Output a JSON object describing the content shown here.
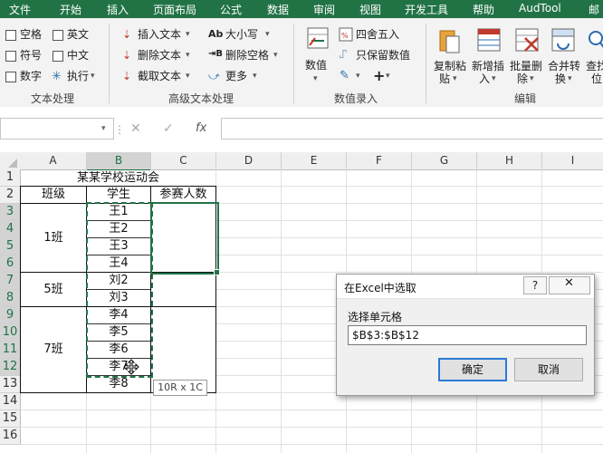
{
  "menu_tabs": [
    "文件",
    "开始",
    "插入",
    "页面布局",
    "公式",
    "数据",
    "审阅",
    "视图",
    "开发工具",
    "帮助",
    "AudTool",
    "邮"
  ],
  "ribbon": {
    "text_group": {
      "options": [
        "空格",
        "英文",
        "符号",
        "中文",
        "数字",
        "执行"
      ],
      "label": "文本处理"
    },
    "advanced_group": {
      "items": [
        "插入文本",
        "删除文本",
        "截取文本",
        "大小写",
        "删除空格",
        "更多"
      ],
      "label": "高级文本处理"
    },
    "value_group": {
      "value_button": "数值",
      "round": "四舍五入",
      "keep_values": "只保留数值",
      "label": "数值录入"
    },
    "edit_group": {
      "buttons": [
        {
          "line1": "复制粘",
          "line2": "贴"
        },
        {
          "line1": "新增插",
          "line2": "入"
        },
        {
          "line1": "批量删",
          "line2": "除"
        },
        {
          "line1": "合并转",
          "line2": "换"
        },
        {
          "line1": "查找",
          "line2": "位"
        }
      ],
      "label": "编辑"
    }
  },
  "formula_bar": {
    "fx": "fx",
    "name_box": "",
    "content": ""
  },
  "sheet": {
    "columns": [
      "A",
      "B",
      "C",
      "D",
      "E",
      "F",
      "G",
      "H",
      "I"
    ],
    "rows": [
      "1",
      "2",
      "3",
      "4",
      "5",
      "6",
      "7",
      "8",
      "9",
      "10",
      "11",
      "12",
      "13",
      "14",
      "15",
      "16"
    ],
    "title": "某某学校运动会",
    "headers": [
      "班级",
      "学生",
      "参赛人数"
    ],
    "classes": [
      "1班",
      "5班",
      "7班"
    ],
    "students": [
      "王1",
      "王2",
      "王3",
      "王4",
      "刘2",
      "刘3",
      "李4",
      "李5",
      "李6",
      "李7",
      "李8"
    ],
    "selection_tooltip": "10R x 1C"
  },
  "dialog": {
    "title": "在Excel中选取",
    "help_button": "?",
    "label": "选择单元格",
    "value": "$B$3:$B$12",
    "ok": "确定",
    "cancel": "取消"
  },
  "colors": {
    "accent": "#217346",
    "selection": "#217346"
  }
}
